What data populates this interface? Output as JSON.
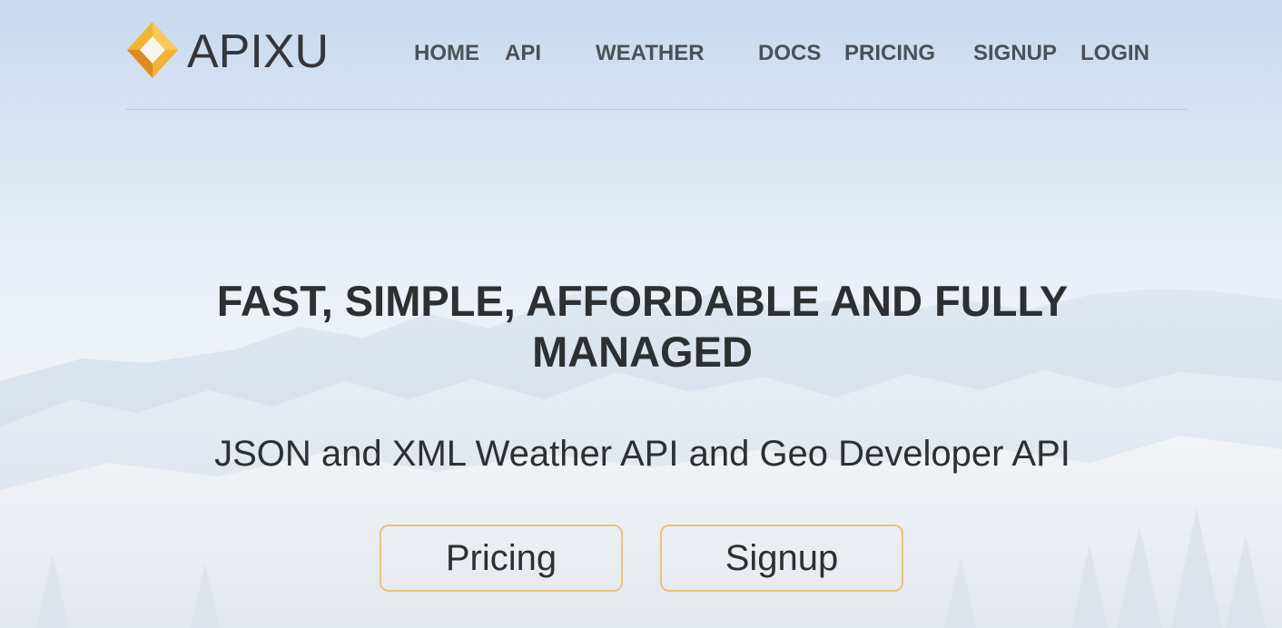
{
  "brand": {
    "name": "APIXU",
    "logo_icon": "diamond-logo-icon",
    "logo_colors": [
      "#f2b232",
      "#dd8a1e",
      "#f7c95a"
    ]
  },
  "nav": {
    "items": [
      {
        "label": "HOME"
      },
      {
        "label": "API"
      },
      {
        "label": "WEATHER"
      },
      {
        "label": "DOCS"
      },
      {
        "label": "PRICING"
      },
      {
        "label": "SIGNUP"
      },
      {
        "label": "LOGIN"
      }
    ]
  },
  "hero": {
    "title": "FAST, SIMPLE, AFFORDABLE AND FULLY MANAGED",
    "subtitle": "JSON and XML Weather API and Geo Developer API",
    "buttons": {
      "pricing": "Pricing",
      "signup": "Signup"
    },
    "button_border_color": "#e6c47c"
  },
  "colors": {
    "text": "#2d2f31",
    "nav_text": "#4a5157",
    "sky": "#c9daef"
  }
}
